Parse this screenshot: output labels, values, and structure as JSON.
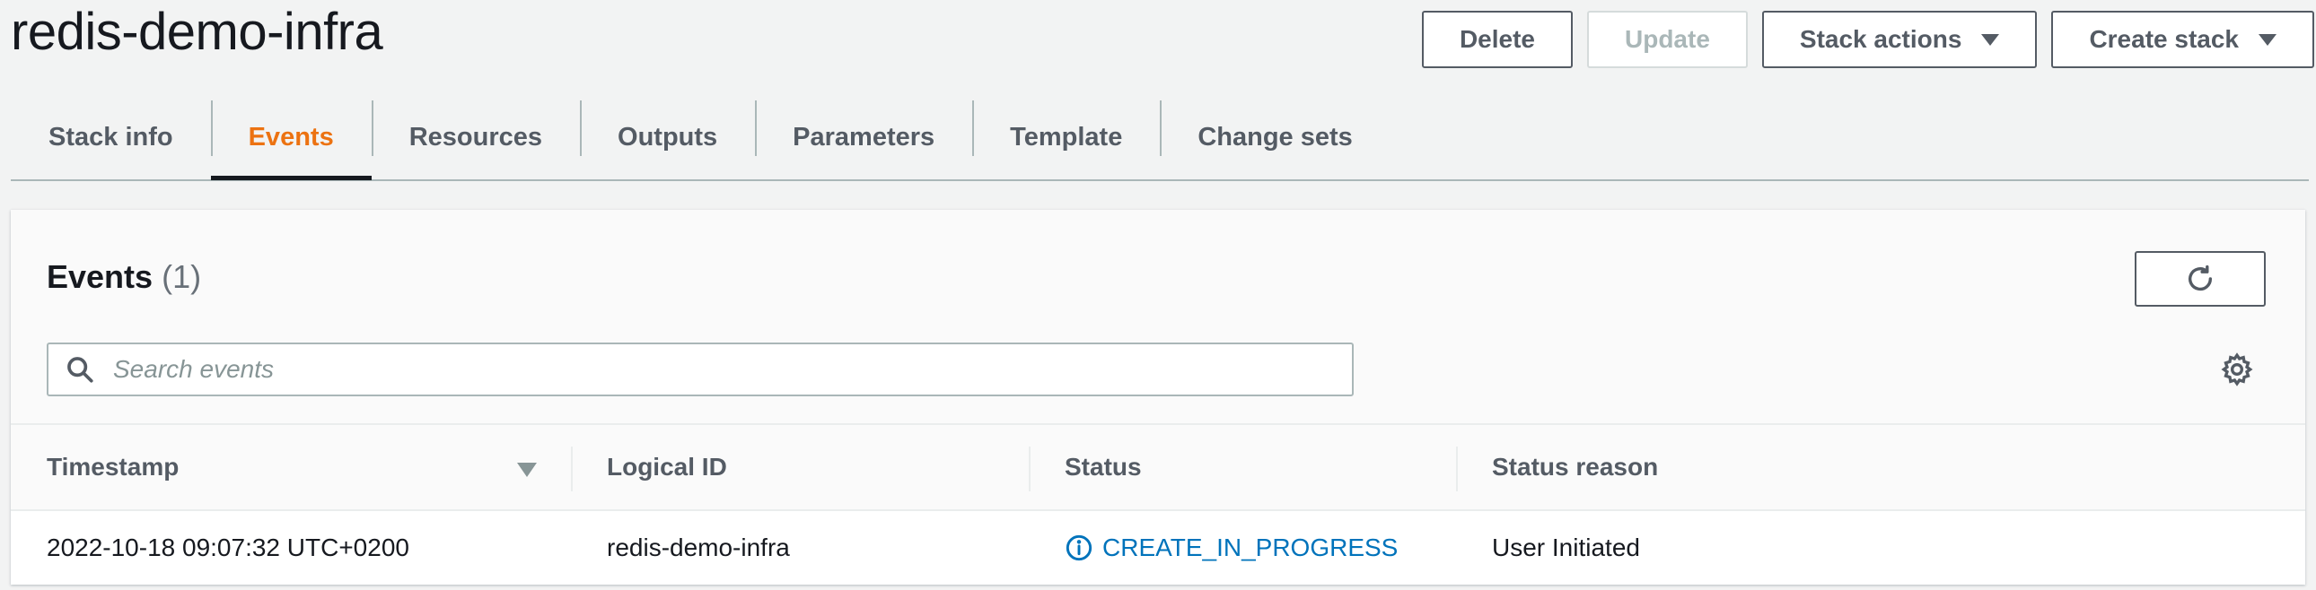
{
  "page": {
    "title": "redis-demo-infra"
  },
  "header_actions": {
    "delete": "Delete",
    "update": "Update",
    "stack_actions": "Stack actions",
    "create_stack": "Create stack"
  },
  "tabs": [
    {
      "label": "Stack info"
    },
    {
      "label": "Events",
      "active": true
    },
    {
      "label": "Resources"
    },
    {
      "label": "Outputs"
    },
    {
      "label": "Parameters"
    },
    {
      "label": "Template"
    },
    {
      "label": "Change sets"
    }
  ],
  "events_panel": {
    "title": "Events",
    "count": "(1)",
    "search_placeholder": "Search events",
    "icons": {
      "refresh": "refresh-icon",
      "settings": "gear-icon",
      "search": "search-icon",
      "status": "info-icon"
    }
  },
  "table": {
    "columns": [
      "Timestamp",
      "Logical ID",
      "Status",
      "Status reason"
    ],
    "rows": [
      {
        "timestamp": "2022-10-18 09:07:32 UTC+0200",
        "logical_id": "redis-demo-infra",
        "status": "CREATE_IN_PROGRESS",
        "status_reason": "User Initiated"
      }
    ]
  },
  "colors": {
    "accent_active_tab": "#ec7211",
    "status_info": "#0073bb",
    "text_primary": "#16191f",
    "text_secondary": "#545b64"
  }
}
